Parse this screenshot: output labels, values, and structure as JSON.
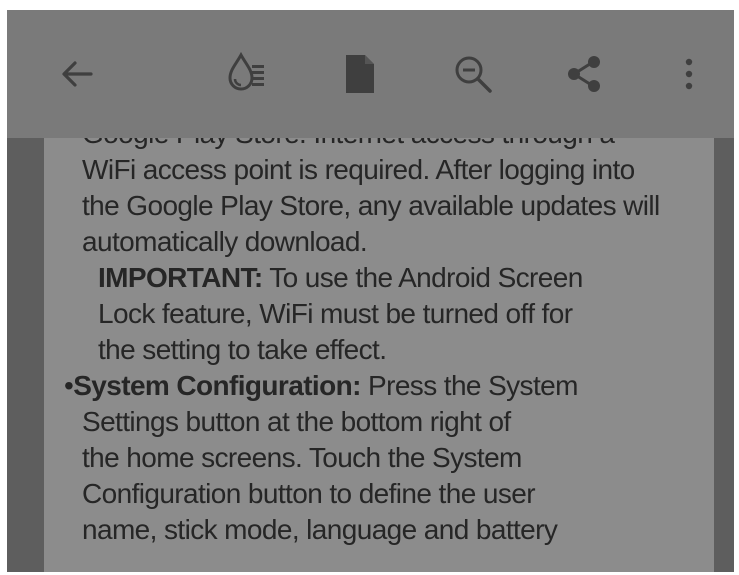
{
  "toolbar": {
    "icons": [
      "back-arrow-icon",
      "reading-mode-icon",
      "document-icon",
      "zoom-out-icon",
      "share-icon",
      "more-options-icon"
    ]
  },
  "document": {
    "cutoff_line": "Google Play Store. Internet access through a",
    "para1_lines": [
      "WiFi access point is required. After logging into",
      "the Google Play Store, any available updates will",
      "automatically download."
    ],
    "important": {
      "label": "IMPORTANT:",
      "line1_rest": " To use the Android Screen",
      "line2": "Lock feature, WiFi must be turned off for",
      "line3": "the setting to take effect."
    },
    "bullet": {
      "marker": "•",
      "label": "System Configuration:",
      "line1_rest": " Press the System",
      "lines": [
        "Settings button at the bottom right of",
        "the home screens. Touch the System",
        "Configuration button to define the user",
        "name, stick mode, language and battery"
      ]
    }
  },
  "colors": {
    "toolbar_bg": "#7a7a7a",
    "page_bg": "#8c8c8c",
    "backdrop": "#5e5e5e",
    "text": "#262626",
    "icon": "#3f3f3f"
  }
}
